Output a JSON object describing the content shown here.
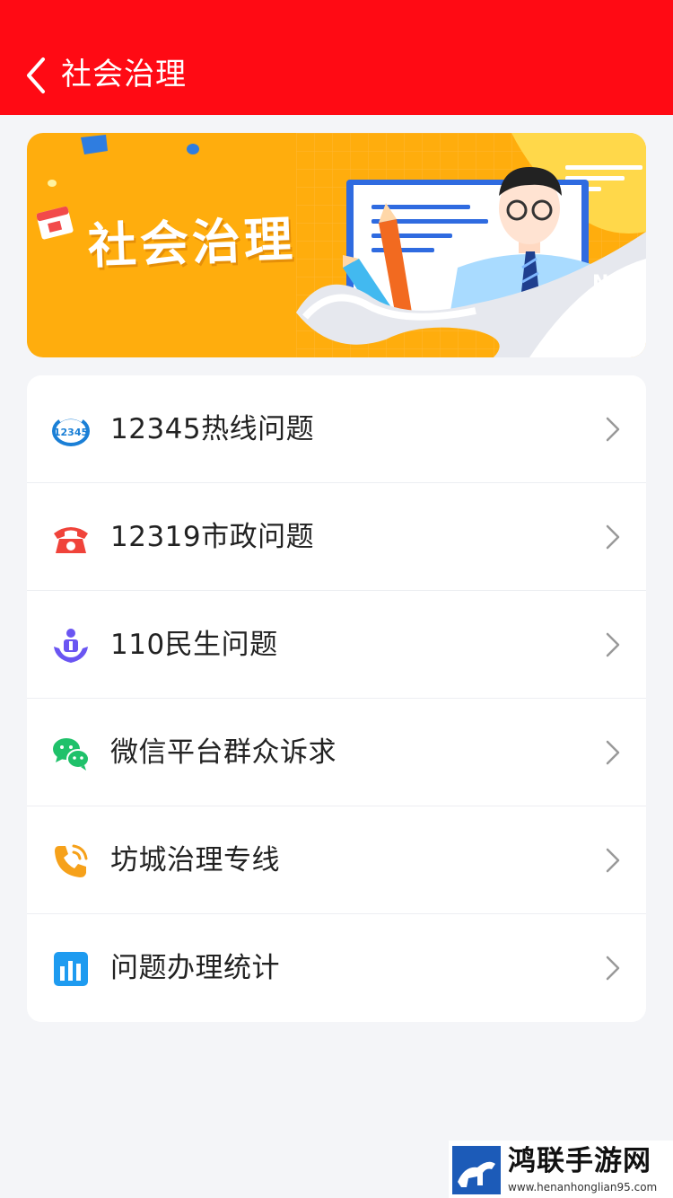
{
  "header": {
    "title": "社会治理",
    "background_color": "#ff0a14"
  },
  "banner": {
    "title": "社会治理",
    "tag": "NICE",
    "background_color": "#ffad0d"
  },
  "menu": {
    "items": [
      {
        "label": "12345热线问题",
        "icon": "hotline-12345-icon",
        "icon_color": "#1a7fd6"
      },
      {
        "label": "12319市政问题",
        "icon": "telephone-icon",
        "icon_color": "#f0433a"
      },
      {
        "label": "110民生问题",
        "icon": "people-care-icon",
        "icon_color": "#6a55f2"
      },
      {
        "label": "微信平台群众诉求",
        "icon": "wechat-icon",
        "icon_color": "#1fc16a"
      },
      {
        "label": "坊城治理专线",
        "icon": "phone-ring-icon",
        "icon_color": "#f6a11a"
      },
      {
        "label": "问题办理统计",
        "icon": "bar-chart-icon",
        "icon_color": "#1e9bf0"
      }
    ]
  },
  "watermark": {
    "text": "鸿联手游网",
    "url": "www.henanhonglian95.com"
  }
}
